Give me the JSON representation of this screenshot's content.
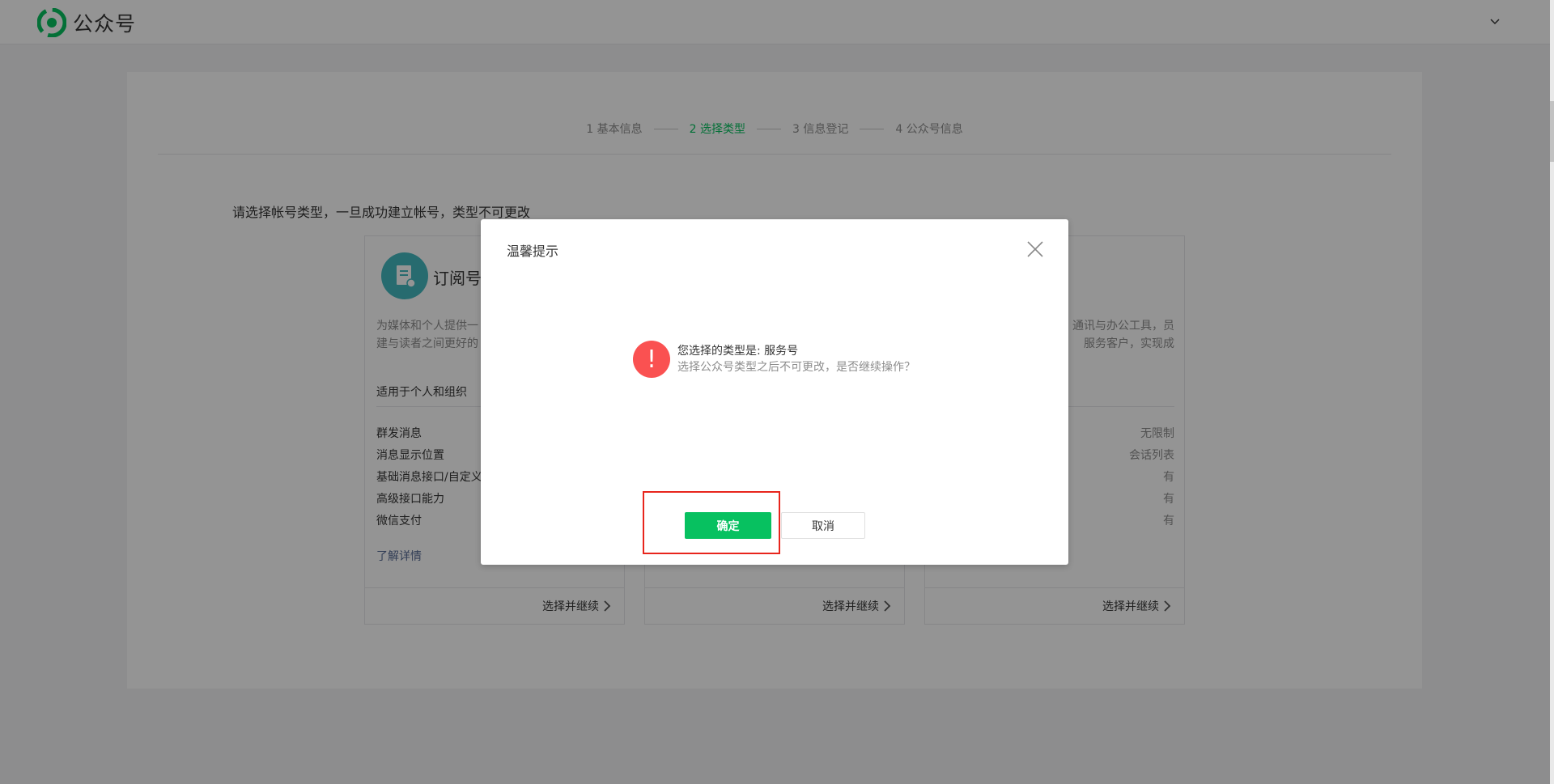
{
  "header": {
    "app_title": "公众号",
    "logo_icon": "wechat-official-account-logo-icon",
    "account_menu_icon": "chevron-down-icon"
  },
  "steps": [
    {
      "label": "1 基本信息",
      "active": false
    },
    {
      "label": "2 选择类型",
      "active": true
    },
    {
      "label": "3 信息登记",
      "active": false
    },
    {
      "label": "4 公众号信息",
      "active": false
    }
  ],
  "main": {
    "prompt": "请选择帐号类型，一旦成功建立帐号，类型不可更改"
  },
  "cards": [
    {
      "title": "订阅号",
      "desc_line1": "为媒体和个人提供一",
      "desc_line2": "建与读者之间更好的",
      "audience": "适用于个人和组织",
      "features": [
        {
          "label": "群发消息",
          "value": ""
        },
        {
          "label": "消息显示位置",
          "value": ""
        },
        {
          "label": "基础消息接口/自定义",
          "value": ""
        },
        {
          "label": "高级接口能力",
          "value": ""
        },
        {
          "label": "微信支付",
          "value": ""
        }
      ],
      "more": "了解详情",
      "action": "选择并继续"
    },
    {
      "action": "选择并继续"
    },
    {
      "desc_line1": "通讯与办公工具，员",
      "desc_line2": "服务客户，实现成",
      "features": [
        {
          "label": "",
          "value": "无限制"
        },
        {
          "label": "",
          "value": "会话列表"
        },
        {
          "label": "",
          "value": "有"
        },
        {
          "label": "",
          "value": "有"
        },
        {
          "label": "",
          "value": "有"
        }
      ],
      "action": "选择并继续"
    }
  ],
  "dialog": {
    "title": "温馨提示",
    "message": "您选择的类型是: 服务号",
    "submessage": "选择公众号类型之后不可更改，是否继续操作？",
    "warn_symbol": "!",
    "ok_label": "确定",
    "cancel_label": "取消"
  },
  "colors": {
    "accent": "#07c160",
    "warning": "#fa5151",
    "highlight": "#e8251c",
    "link": "#576b95"
  }
}
